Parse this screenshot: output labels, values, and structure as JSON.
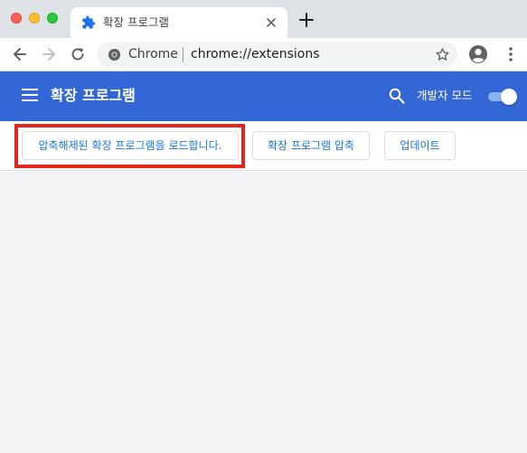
{
  "window": {
    "tab": {
      "title": "확장 프로그램",
      "icon": "puzzle-icon"
    }
  },
  "toolbar": {
    "omnibox": {
      "origin_label": "Chrome",
      "url": "chrome://extensions"
    }
  },
  "extensions_header": {
    "title": "확장 프로그램",
    "dev_mode_label": "개발자 모드",
    "dev_mode_enabled": true
  },
  "action_bar": {
    "load_unpacked_label": "압축해제된 확장 프로그램을 로드합니다.",
    "pack_label": "확장 프로그램 압축",
    "update_label": "업데이트"
  },
  "colors": {
    "header_bg": "#3367d6",
    "highlight": "#e4261b",
    "button_text": "#1a73e8",
    "content_bg": "#f1f3f4"
  }
}
